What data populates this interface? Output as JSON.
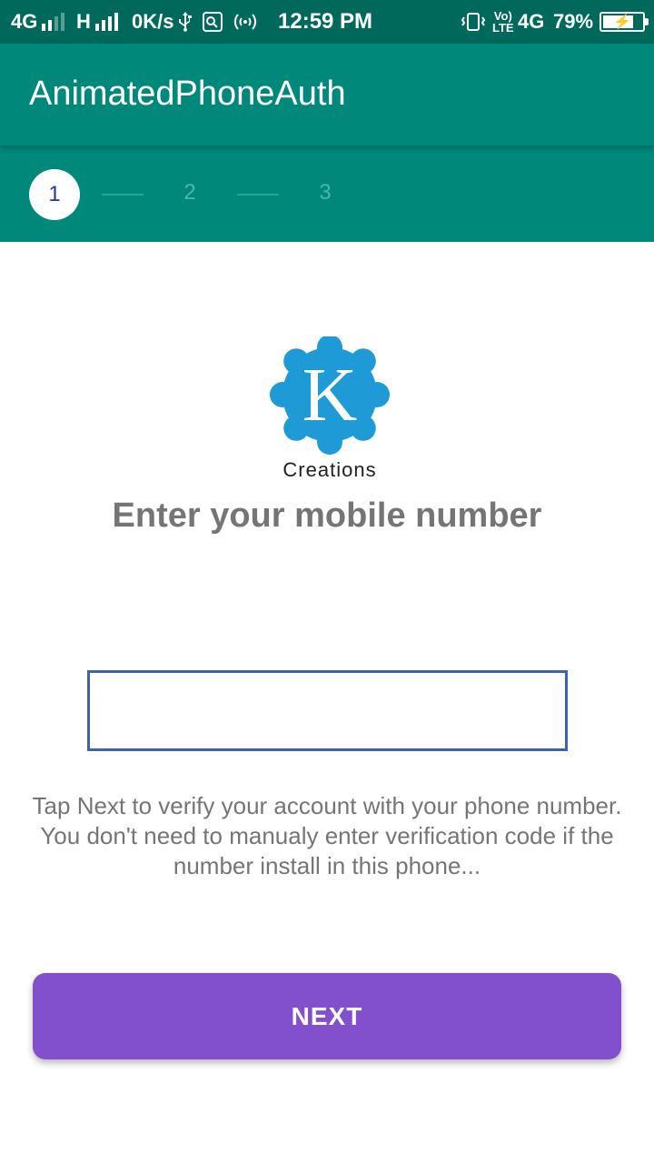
{
  "status_bar": {
    "network1": "4G",
    "network2": "H",
    "speed": "0K/s",
    "time": "12:59 PM",
    "volte_top": "Vo)",
    "volte_bottom": "LTE",
    "network3": "4G",
    "battery": "79%",
    "battery_level": 0.79,
    "icons": [
      "signal-icon",
      "usb-icon",
      "app-notification-icon",
      "hotspot-icon",
      "vibrate-icon",
      "battery-charging-icon"
    ]
  },
  "app_bar": {
    "title": "AnimatedPhoneAuth"
  },
  "stepper": {
    "step1": "1",
    "step2": "2",
    "step3": "3",
    "active_step": 1
  },
  "logo": {
    "letter": "K",
    "text": "Creations",
    "color": "#1e9bd7"
  },
  "main": {
    "heading": "Enter your mobile number",
    "phone_value": "",
    "info": "Tap Next to verify your account with your phone number. You don't need to manualy enter verification code if the number install in this phone..."
  },
  "button": {
    "next_label": "NEXT"
  },
  "colors": {
    "status_bar": "#00695c",
    "primary": "#00897b",
    "accent": "#8250cc",
    "input_border": "#3b64ad"
  }
}
